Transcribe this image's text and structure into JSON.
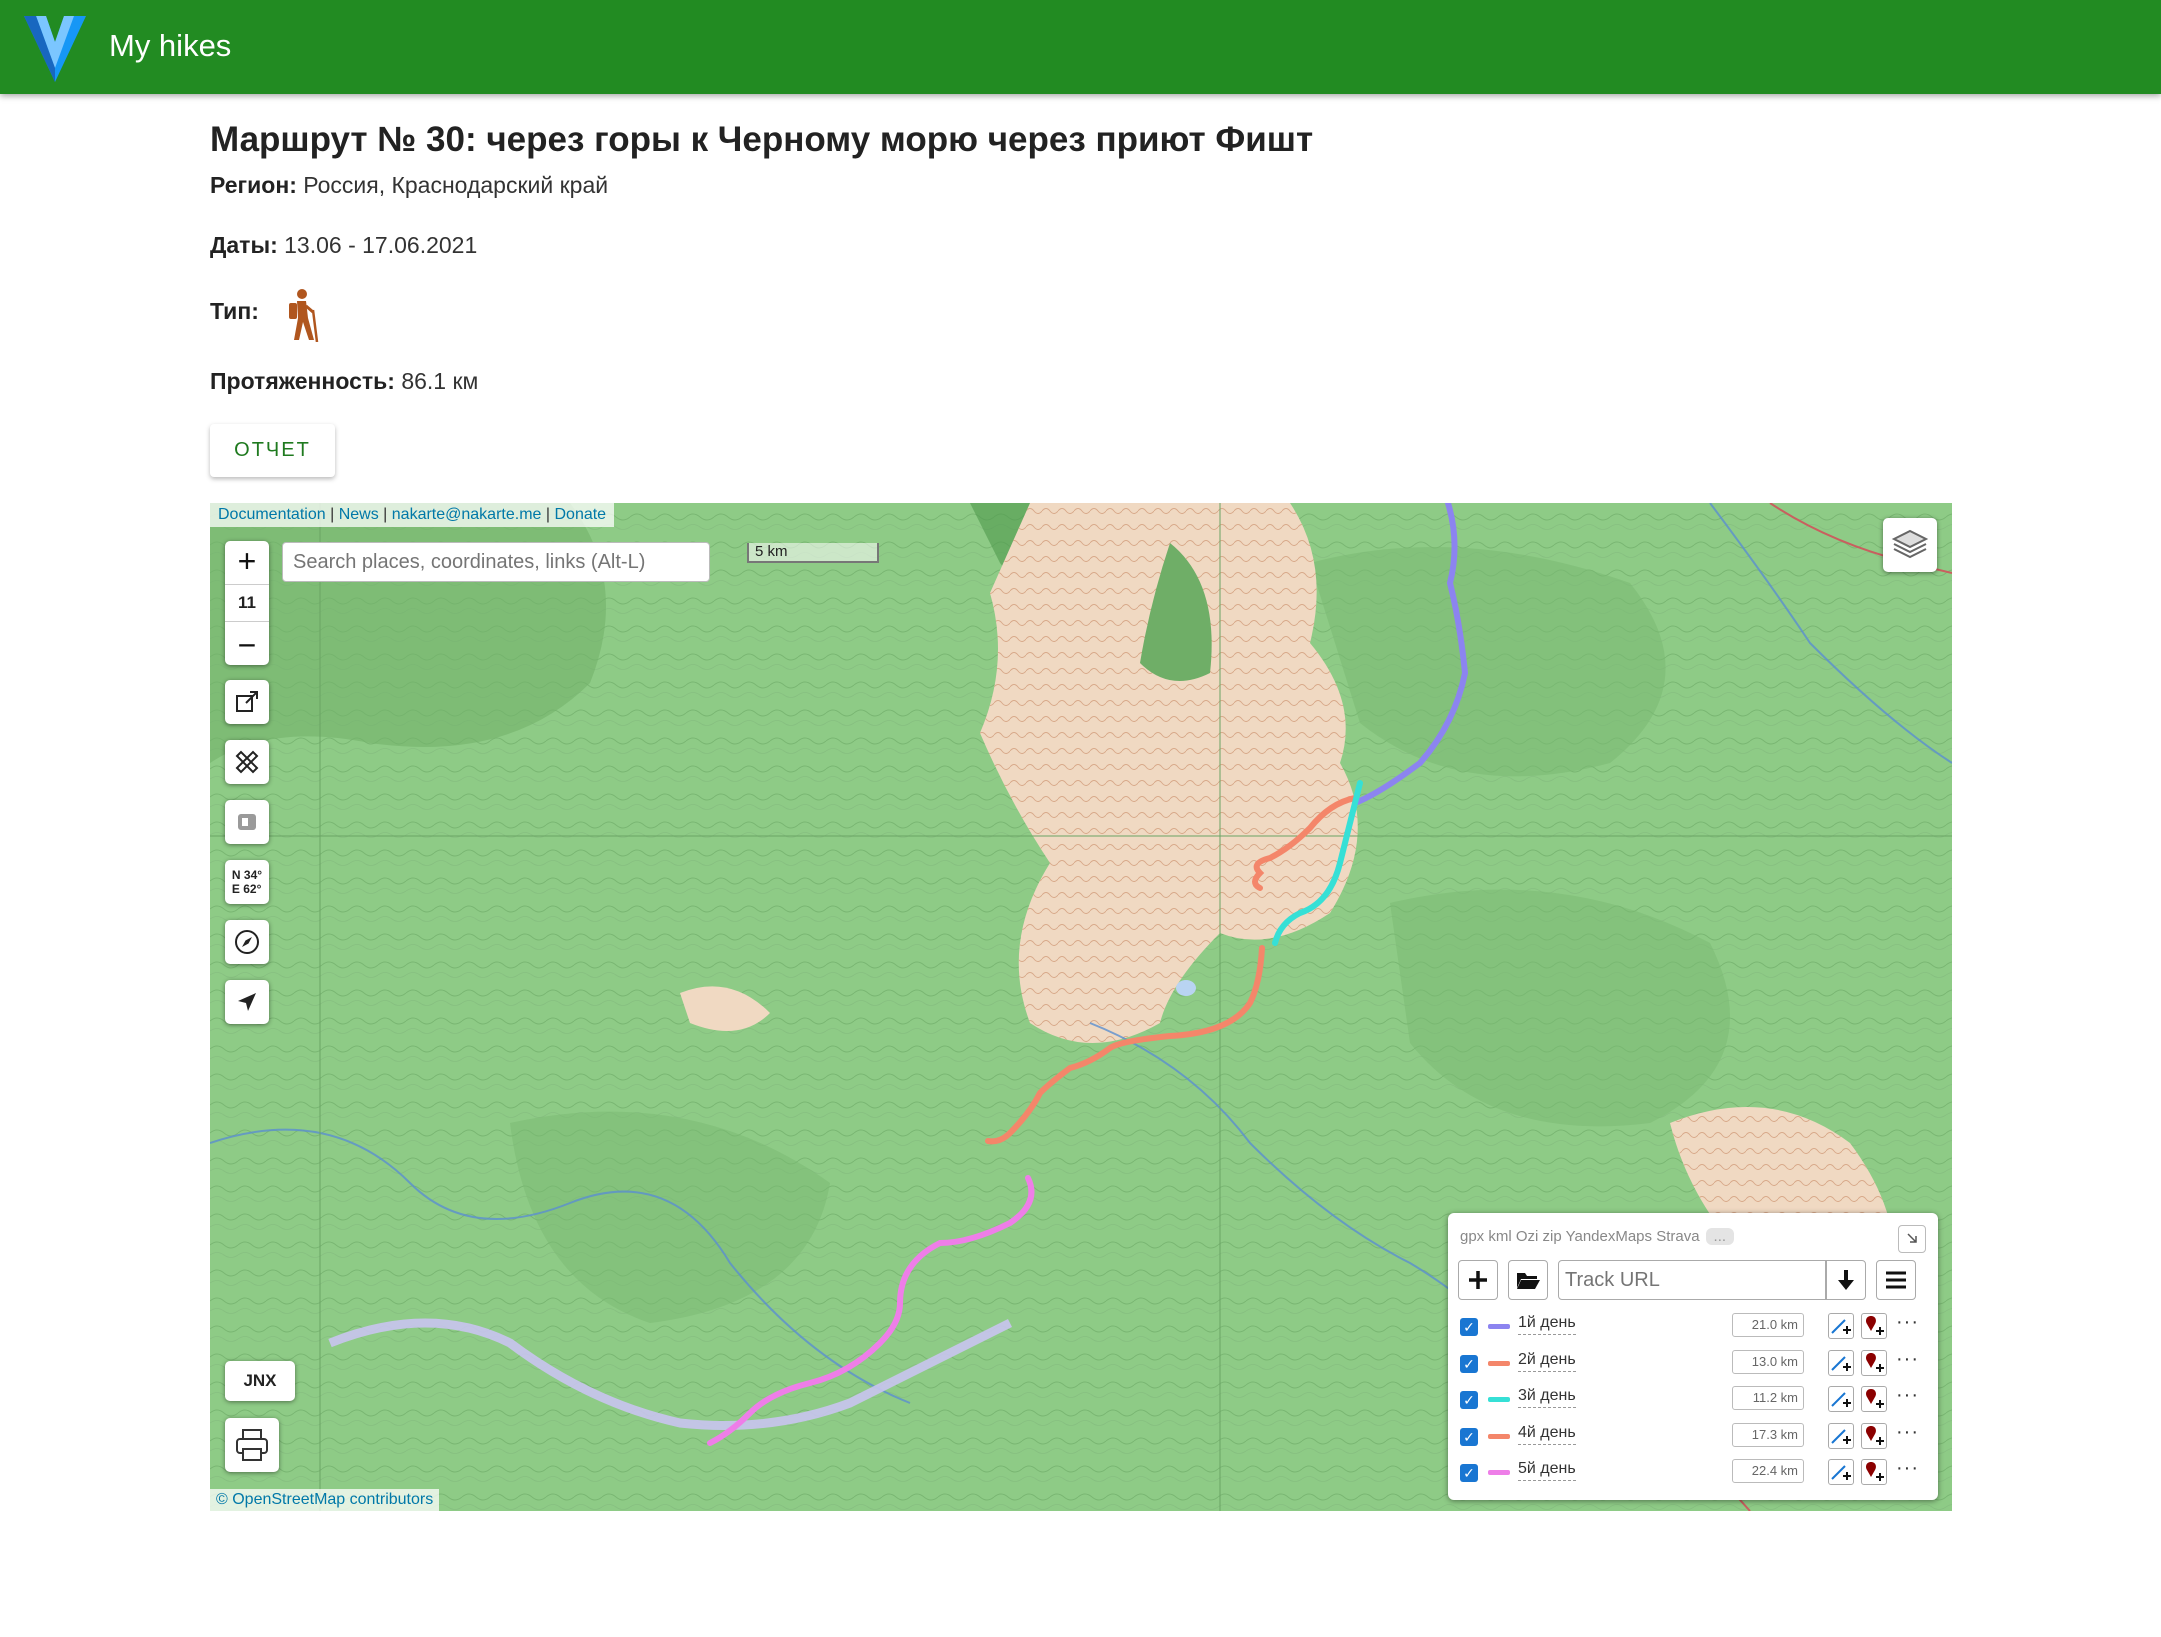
{
  "app": {
    "title": "My hikes",
    "bar_color": "#228b22"
  },
  "route": {
    "title": "Маршрут № 30: через горы к Черному морю через приют Фишт",
    "region_label": "Регион:",
    "region_value": "Россия, Краснодарский край",
    "dates_label": "Даты:",
    "dates_value": "13.06 - 17.06.2021",
    "type_label": "Тип:",
    "type_icon": "hiker-icon",
    "length_label": "Протяженность:",
    "length_value": "86.1 км",
    "report_button": "ОТЧЕТ"
  },
  "map": {
    "links": [
      "Documentation",
      "News",
      "nakarte@nakarte.me",
      "Donate"
    ],
    "separator": "|",
    "search_placeholder": "Search places, coordinates, links (Alt-L)",
    "zoom_in": "+",
    "zoom_level": "11",
    "zoom_out": "−",
    "scale": "5 km",
    "coords": {
      "lat": "N 34°",
      "lon": "E 62°"
    },
    "jnx_label": "JNX",
    "attribution": "© OpenStreetMap contributors",
    "tracks_panel": {
      "formats": "gpx kml Ozi zip YandexMaps Strava",
      "more": "...",
      "url_placeholder": "Track URL",
      "tracks": [
        {
          "name": "1й день",
          "distance": "21.0 km",
          "color": "#8c84f0",
          "checked": true
        },
        {
          "name": "2й день",
          "distance": "13.0 km",
          "color": "#f4866a",
          "checked": true
        },
        {
          "name": "3й день",
          "distance": "11.2 km",
          "color": "#36e0d6",
          "checked": true
        },
        {
          "name": "4й день",
          "distance": "17.3 km",
          "color": "#f4866a",
          "checked": true
        },
        {
          "name": "5й день",
          "distance": "22.4 km",
          "color": "#ee7ee8",
          "checked": true
        }
      ]
    }
  }
}
